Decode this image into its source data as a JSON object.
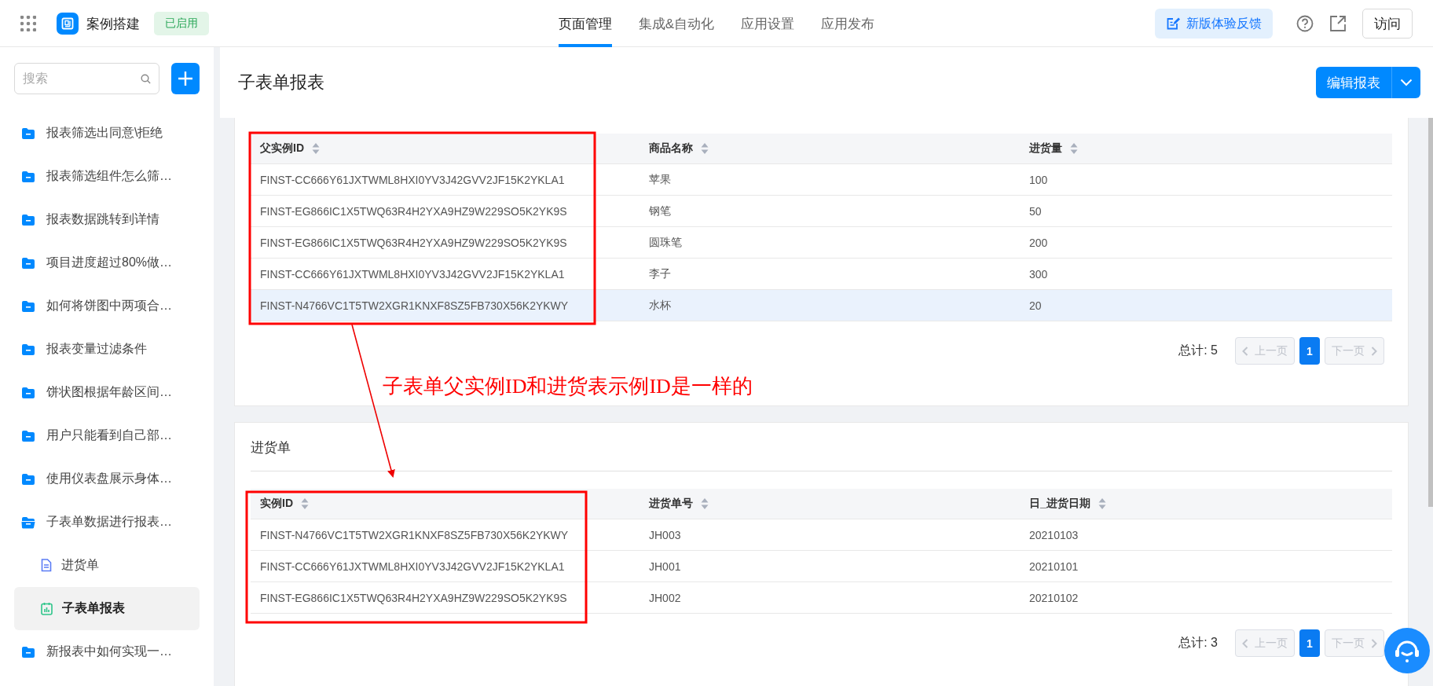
{
  "header": {
    "app_name": "案例搭建",
    "status": "已启用",
    "feedback_button": "新版体验反馈",
    "visit_button": "访问",
    "nav": [
      {
        "label": "页面管理",
        "selected": true
      },
      {
        "label": "集成&自动化",
        "selected": false
      },
      {
        "label": "应用设置",
        "selected": false
      },
      {
        "label": "应用发布",
        "selected": false
      }
    ]
  },
  "sidebar": {
    "search_placeholder": "搜索",
    "items": [
      {
        "label": "报表筛选出同意\\拒绝",
        "kind": "folder",
        "expanded": false,
        "selected": false
      },
      {
        "label": "报表筛选组件怎么筛…",
        "kind": "folder",
        "expanded": false,
        "selected": false
      },
      {
        "label": "报表数据跳转到详情",
        "kind": "folder",
        "expanded": false,
        "selected": false
      },
      {
        "label": "项目进度超过80%做…",
        "kind": "folder",
        "expanded": false,
        "selected": false
      },
      {
        "label": "如何将饼图中两项合…",
        "kind": "folder",
        "expanded": false,
        "selected": false
      },
      {
        "label": "报表变量过滤条件",
        "kind": "folder",
        "expanded": false,
        "selected": false
      },
      {
        "label": "饼状图根据年龄区间…",
        "kind": "folder",
        "expanded": false,
        "selected": false
      },
      {
        "label": "用户只能看到自己部…",
        "kind": "folder",
        "expanded": false,
        "selected": false
      },
      {
        "label": "使用仪表盘展示身体…",
        "kind": "folder",
        "expanded": false,
        "selected": false
      },
      {
        "label": "子表单数据进行报表…",
        "kind": "folder",
        "expanded": true,
        "selected": false,
        "children": [
          {
            "label": "进货单",
            "kind": "form",
            "selected": false
          },
          {
            "label": "子表单报表",
            "kind": "report",
            "selected": true
          }
        ]
      },
      {
        "label": "新报表中如何实现一…",
        "kind": "folder",
        "expanded": false,
        "selected": false
      }
    ]
  },
  "page": {
    "title": "子表单报表",
    "edit_button": "编辑报表"
  },
  "cards": [
    {
      "columns": [
        "父实例ID",
        "商品名称",
        "进货量"
      ],
      "rows": [
        {
          "cells": [
            "FINST-CC666Y61JXTWML8HXI0YV3J42GVV2JF15K2YKLA1",
            "苹果",
            "100"
          ],
          "highlighted": false
        },
        {
          "cells": [
            "FINST-EG866IC1X5TWQ63R4H2YXA9HZ9W229SO5K2YK9S",
            "钢笔",
            "50"
          ],
          "highlighted": false
        },
        {
          "cells": [
            "FINST-EG866IC1X5TWQ63R4H2YXA9HZ9W229SO5K2YK9S",
            "圆珠笔",
            "200"
          ],
          "highlighted": false
        },
        {
          "cells": [
            "FINST-CC666Y61JXTWML8HXI0YV3J42GVV2JF15K2YKLA1",
            "李子",
            "300"
          ],
          "highlighted": false
        },
        {
          "cells": [
            "FINST-N4766VC1T5TW2XGR1KNXF8SZ5FB730X56K2YKWY",
            "水杯",
            "20"
          ],
          "highlighted": true
        }
      ],
      "total": "总计: 5",
      "prev": "上一页",
      "page": "1",
      "next": "下一页"
    },
    {
      "title": "进货单",
      "columns": [
        "实例ID",
        "进货单号",
        "日_进货日期"
      ],
      "rows": [
        {
          "cells": [
            "FINST-N4766VC1T5TW2XGR1KNXF8SZ5FB730X56K2YKWY",
            "JH003",
            "20210103"
          ],
          "highlighted": false
        },
        {
          "cells": [
            "FINST-CC666Y61JXTWML8HXI0YV3J42GVV2JF15K2YKLA1",
            "JH001",
            "20210101"
          ],
          "highlighted": false
        },
        {
          "cells": [
            "FINST-EG866IC1X5TWQ63R4H2YXA9HZ9W229SO5K2YK9S",
            "JH002",
            "20210102"
          ],
          "highlighted": false
        }
      ],
      "total": "总计: 3",
      "prev": "上一页",
      "page": "1",
      "next": "下一页"
    }
  ],
  "annotation": {
    "text": "子表单父实例ID和进货表示例ID是一样的"
  }
}
